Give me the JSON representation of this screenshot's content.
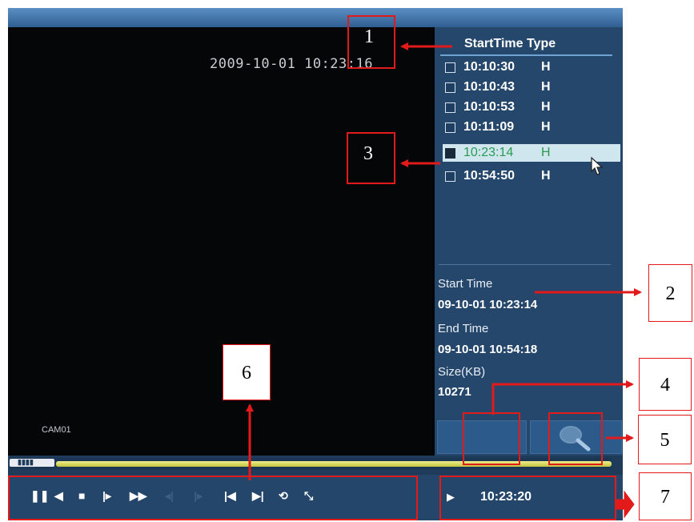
{
  "osd": {
    "datetime": "2009-10-01 10:23:16",
    "camera": "CAM01"
  },
  "record_list": {
    "header": "StartTime Type",
    "items": [
      {
        "time": "10:10:30",
        "type": "H",
        "selected": false
      },
      {
        "time": "10:10:43",
        "type": "H",
        "selected": false
      },
      {
        "time": "10:10:53",
        "type": "H",
        "selected": false
      },
      {
        "time": "10:11:09",
        "type": "H",
        "selected": false
      },
      {
        "time": "10:23:14",
        "type": "H",
        "selected": true
      },
      {
        "time": "10:54:50",
        "type": "H",
        "selected": false
      }
    ]
  },
  "record_info": {
    "start_label": "Start Time",
    "start_value": "09-10-01 10:23:14",
    "end_label": "End Time",
    "end_value": "09-10-01 10:54:18",
    "size_label": "Size(KB)",
    "size_value": "10271"
  },
  "playback": {
    "clock": "10:23:20",
    "progress_label": "▮▮▮▮",
    "controls": [
      {
        "name": "pause-icon",
        "glyph": "❚❚",
        "enabled": true
      },
      {
        "name": "play-backward-icon",
        "glyph": "◀",
        "enabled": true
      },
      {
        "name": "stop-icon",
        "glyph": "■",
        "enabled": true
      },
      {
        "name": "slow-play-icon",
        "glyph": "|▸",
        "enabled": true
      },
      {
        "name": "fast-forward-icon",
        "glyph": "▶▶",
        "enabled": true
      },
      {
        "name": "prev-frame-icon",
        "glyph": "◂|",
        "enabled": false
      },
      {
        "name": "next-frame-icon",
        "glyph": "|▸",
        "enabled": false
      },
      {
        "name": "prev-file-icon",
        "glyph": "|◀",
        "enabled": true
      },
      {
        "name": "next-file-icon",
        "glyph": "▶|",
        "enabled": true
      },
      {
        "name": "repeat-icon",
        "glyph": "⟲",
        "enabled": true
      },
      {
        "name": "fullscreen-icon",
        "glyph": "⤡",
        "enabled": true
      }
    ]
  },
  "annotations": {
    "labels": [
      "1",
      "2",
      "3",
      "4",
      "5",
      "6",
      "7"
    ]
  },
  "colors": {
    "panel": "#25476b",
    "video": "#050608",
    "annotation": "#e21a1a",
    "selected_text": "#2a9a52"
  }
}
